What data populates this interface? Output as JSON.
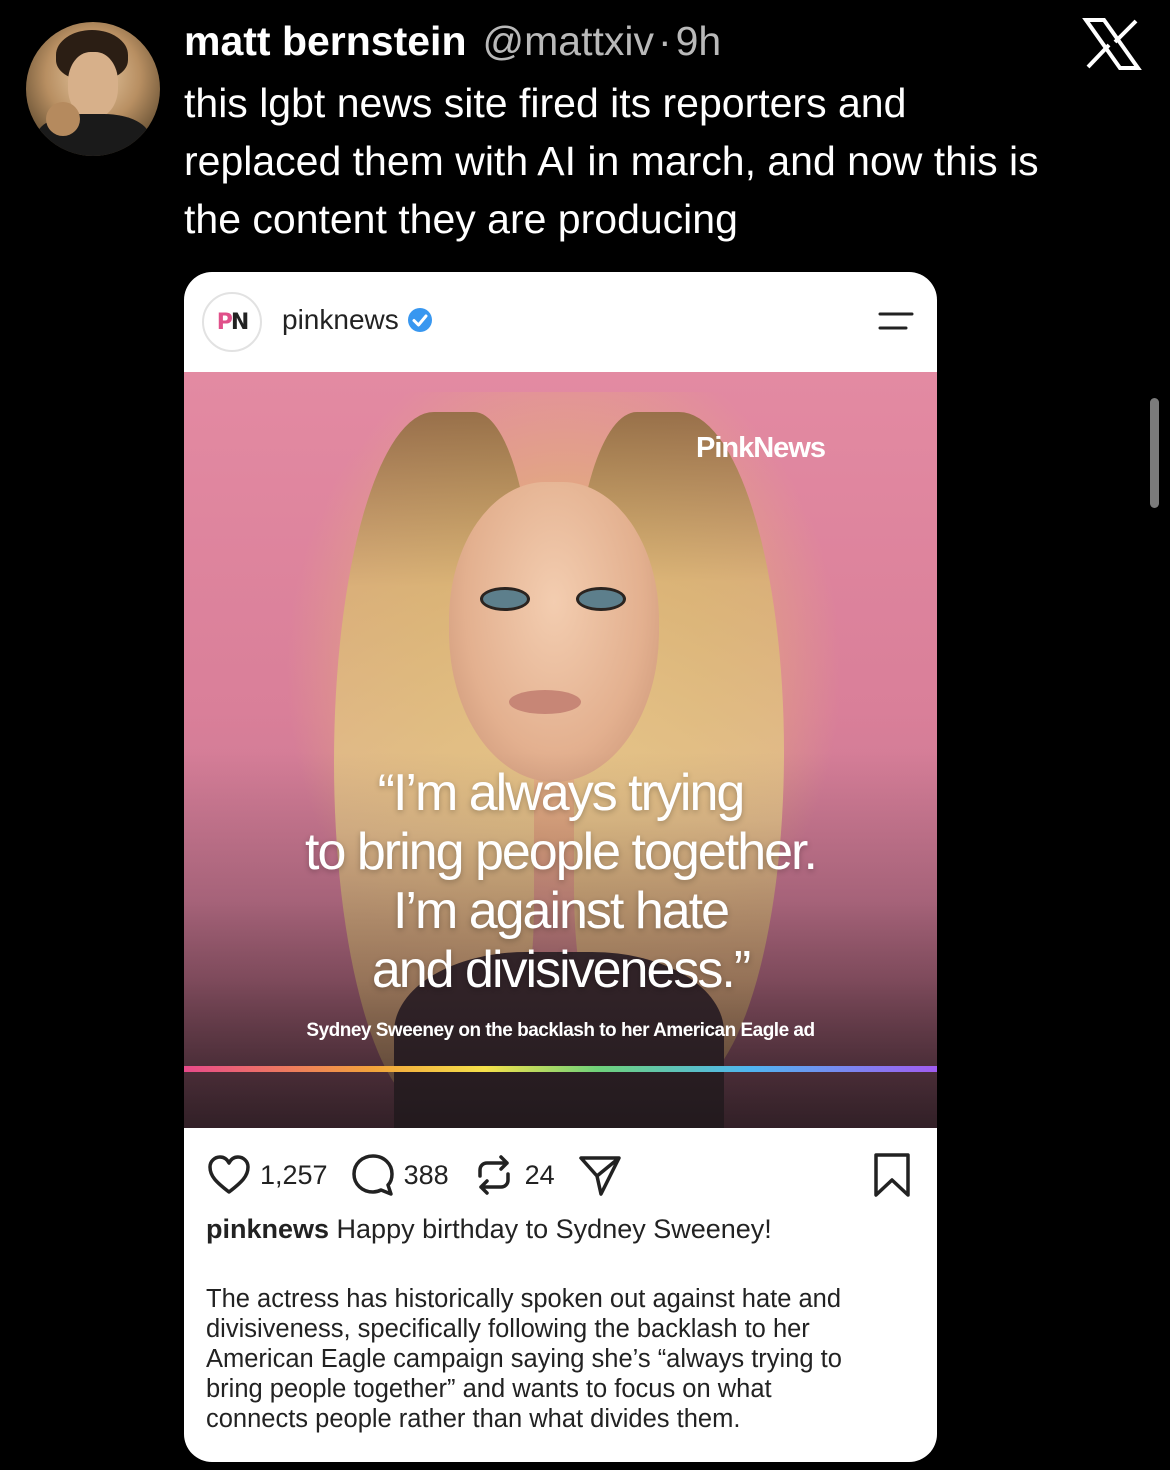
{
  "tweet": {
    "author_name": "matt bernstein",
    "handle": "@mattxiv",
    "separator": "·",
    "time": "9h",
    "text": "this lgbt news site fired its reporters and\nreplaced them with AI in march, and now this is\nthe content they are producing"
  },
  "embed": {
    "account_name": "pinknews",
    "logo_text": "PN",
    "image": {
      "brand_text": "PinkNews",
      "quote": "“I’m always trying\nto bring people together.\nI’m against hate\nand divisiveness.”",
      "caption": "Sydney Sweeney on the backlash to her American Eagle ad"
    },
    "stats": {
      "likes": "1,257",
      "comments": "388",
      "reposts": "24"
    },
    "caption_user": "pinknews",
    "caption_text": "Happy birthday to Sydney Sweeney!",
    "body": "The actress has historically spoken out against hate and\ndivisiveness, specifically following the backlash to her\nAmerican Eagle campaign saying she’s “always trying to\nbring people together” and wants to focus on what\nconnects people rather than what divides them."
  },
  "colors": {
    "background": "#000000",
    "handle_gray": "#b9b9b9",
    "card_bg": "#ffffff",
    "image_pink": "#e38aa2",
    "verified_blue": "#3897f0"
  },
  "icons": [
    "x-logo-icon",
    "verified-icon",
    "menu-icon",
    "heart-icon",
    "comment-icon",
    "repost-icon",
    "share-icon",
    "bookmark-icon"
  ]
}
